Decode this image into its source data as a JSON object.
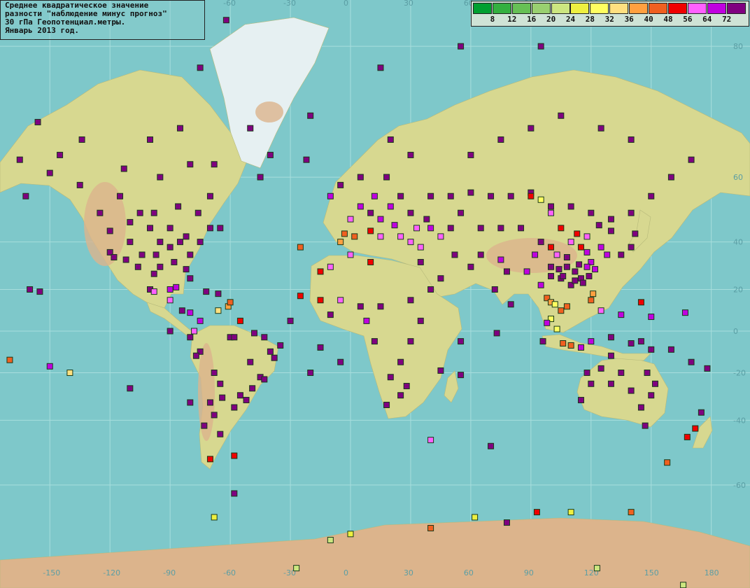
{
  "info": {
    "line1": "Среднее квадратическое значение",
    "line2": "разности \"наблюдение минус прогноз\"",
    "line3": "30 гПа Геопотенциал.метры.",
    "line4": "Январь 2013 год."
  },
  "legend": {
    "labels": [
      "8",
      "12",
      "16",
      "20",
      "24",
      "28",
      "32",
      "36",
      "40",
      "48",
      "56",
      "64",
      "72"
    ],
    "colors": [
      "#00a030",
      "#33b040",
      "#66c055",
      "#99d070",
      "#cce680",
      "#eef040",
      "#ffff60",
      "#ffe080",
      "#ffa040",
      "#f06020",
      "#f00000",
      "#ff60ff",
      "#c000e0",
      "#800080"
    ]
  },
  "axes": {
    "lon_labels": [
      "-150",
      "-120",
      "-90",
      "-60",
      "-30",
      "0",
      "30",
      "60",
      "90",
      "120",
      "150",
      "180"
    ],
    "lat_labels": [
      "80",
      "60",
      "40",
      "20",
      "0",
      "-20",
      "-40",
      "-60"
    ],
    "top_lon_labels": [
      "-60",
      "-30",
      "0",
      "30",
      "60",
      "90",
      "120",
      "150",
      "180"
    ]
  },
  "map_colors": {
    "ocean": "#7ec8ca",
    "land": "#d7d890",
    "highland": "#dcb48c",
    "ice": "#e6f0f2",
    "grid": "#a8dedd"
  },
  "stations": [
    {
      "lon": -97,
      "lat": 35,
      "c": 13
    },
    {
      "lon": -90,
      "lat": 38,
      "c": 13
    },
    {
      "lon": -85,
      "lat": 40,
      "c": 13
    },
    {
      "lon": -100,
      "lat": 45,
      "c": 13
    },
    {
      "lon": -110,
      "lat": 40,
      "c": 13
    },
    {
      "lon": -120,
      "lat": 44,
      "c": 13
    },
    {
      "lon": -80,
      "lat": 35,
      "c": 13
    },
    {
      "lon": -75,
      "lat": 40,
      "c": 13
    },
    {
      "lon": -95,
      "lat": 30,
      "c": 13
    },
    {
      "lon": -105,
      "lat": 50,
      "c": 13
    },
    {
      "lon": -115,
      "lat": 55,
      "c": 13
    },
    {
      "lon": -125,
      "lat": 50,
      "c": 13
    },
    {
      "lon": -135,
      "lat": 58,
      "c": 13
    },
    {
      "lon": -150,
      "lat": 61,
      "c": 13
    },
    {
      "lon": -165,
      "lat": 64,
      "c": 13
    },
    {
      "lon": -95,
      "lat": 60,
      "c": 13
    },
    {
      "lon": -70,
      "lat": 55,
      "c": 13
    },
    {
      "lon": -65,
      "lat": 45,
      "c": 13
    },
    {
      "lon": -100,
      "lat": 20,
      "c": 13
    },
    {
      "lon": -90,
      "lat": 15,
      "c": 11
    },
    {
      "lon": -80,
      "lat": 25,
      "c": 13
    },
    {
      "lon": -106,
      "lat": 30,
      "c": 13
    },
    {
      "lon": -85,
      "lat": 70,
      "c": 13
    },
    {
      "lon": -62,
      "lat": 82,
      "c": 13
    },
    {
      "lon": -75,
      "lat": 78,
      "c": 13
    },
    {
      "lon": -40,
      "lat": 65,
      "c": 13
    },
    {
      "lon": -22,
      "lat": 64,
      "c": 13
    },
    {
      "lon": -20,
      "lat": 72,
      "c": 13
    },
    {
      "lon": -50,
      "lat": 70,
      "c": 13
    },
    {
      "lon": -60,
      "lat": -3,
      "c": 13
    },
    {
      "lon": -50,
      "lat": -15,
      "c": 13
    },
    {
      "lon": -45,
      "lat": -22,
      "c": 13
    },
    {
      "lon": -55,
      "lat": -30,
      "c": 13
    },
    {
      "lon": -65,
      "lat": -25,
      "c": 13
    },
    {
      "lon": -70,
      "lat": -33,
      "c": 13
    },
    {
      "lon": -75,
      "lat": -10,
      "c": 13
    },
    {
      "lon": -40,
      "lat": -10,
      "c": 13
    },
    {
      "lon": -35,
      "lat": -7,
      "c": 13
    },
    {
      "lon": -65,
      "lat": -45,
      "c": 13
    },
    {
      "lon": -70,
      "lat": -53,
      "c": 10
    },
    {
      "lon": -58,
      "lat": -52,
      "c": 10
    },
    {
      "lon": -78,
      "lat": 0,
      "c": 11
    },
    {
      "lon": -75,
      "lat": 5,
      "c": 12
    },
    {
      "lon": -66,
      "lat": 10,
      "c": 7
    },
    {
      "lon": -61,
      "lat": 12,
      "c": 8
    },
    {
      "lon": -55,
      "lat": 5,
      "c": 10
    },
    {
      "lon": -175,
      "lat": -20,
      "c": 4
    },
    {
      "lon": -150,
      "lat": -17,
      "c": 12
    },
    {
      "lon": -160,
      "lat": 20,
      "c": 13
    },
    {
      "lon": -155,
      "lat": 19,
      "c": 13
    },
    {
      "lon": -170,
      "lat": -14,
      "c": 9
    },
    {
      "lon": 10,
      "lat": 50,
      "c": 13
    },
    {
      "lon": 20,
      "lat": 52,
      "c": 12
    },
    {
      "lon": 15,
      "lat": 48,
      "c": 12
    },
    {
      "lon": 25,
      "lat": 55,
      "c": 13
    },
    {
      "lon": 30,
      "lat": 50,
      "c": 13
    },
    {
      "lon": 5,
      "lat": 52,
      "c": 12
    },
    {
      "lon": 0,
      "lat": 48,
      "c": 11
    },
    {
      "lon": -5,
      "lat": 40,
      "c": 8
    },
    {
      "lon": -3,
      "lat": 43,
      "c": 9
    },
    {
      "lon": 2,
      "lat": 42,
      "c": 9
    },
    {
      "lon": 10,
      "lat": 44,
      "c": 10
    },
    {
      "lon": 15,
      "lat": 42,
      "c": 11
    },
    {
      "lon": 25,
      "lat": 42,
      "c": 11
    },
    {
      "lon": 30,
      "lat": 40,
      "c": 11
    },
    {
      "lon": 35,
      "lat": 38,
      "c": 11
    },
    {
      "lon": 40,
      "lat": 45,
      "c": 12
    },
    {
      "lon": 45,
      "lat": 42,
      "c": 11
    },
    {
      "lon": 38,
      "lat": 48,
      "c": 13
    },
    {
      "lon": 40,
      "lat": 55,
      "c": 13
    },
    {
      "lon": 50,
      "lat": 55,
      "c": 13
    },
    {
      "lon": 60,
      "lat": 56,
      "c": 13
    },
    {
      "lon": 70,
      "lat": 55,
      "c": 13
    },
    {
      "lon": 80,
      "lat": 55,
      "c": 13
    },
    {
      "lon": 90,
      "lat": 56,
      "c": 13
    },
    {
      "lon": 100,
      "lat": 52,
      "c": 13
    },
    {
      "lon": 110,
      "lat": 52,
      "c": 13
    },
    {
      "lon": 120,
      "lat": 50,
      "c": 13
    },
    {
      "lon": 130,
      "lat": 48,
      "c": 13
    },
    {
      "lon": 140,
      "lat": 50,
      "c": 13
    },
    {
      "lon": 150,
      "lat": 55,
      "c": 13
    },
    {
      "lon": 160,
      "lat": 60,
      "c": 13
    },
    {
      "lon": 170,
      "lat": 64,
      "c": 13
    },
    {
      "lon": 60,
      "lat": 65,
      "c": 13
    },
    {
      "lon": 75,
      "lat": 68,
      "c": 13
    },
    {
      "lon": 90,
      "lat": 70,
      "c": 13
    },
    {
      "lon": 105,
      "lat": 72,
      "c": 13
    },
    {
      "lon": 125,
      "lat": 70,
      "c": 13
    },
    {
      "lon": 140,
      "lat": 68,
      "c": 13
    },
    {
      "lon": 30,
      "lat": 65,
      "c": 13
    },
    {
      "lon": 20,
      "lat": 68,
      "c": 13
    },
    {
      "lon": 15,
      "lat": 78,
      "c": 13
    },
    {
      "lon": 55,
      "lat": 80,
      "c": 13
    },
    {
      "lon": 95,
      "lat": 80,
      "c": 13
    },
    {
      "lon": 90,
      "lat": 55,
      "c": 10
    },
    {
      "lon": 95,
      "lat": 54,
      "c": 6
    },
    {
      "lon": 100,
      "lat": 50,
      "c": 11
    },
    {
      "lon": 105,
      "lat": 45,
      "c": 10
    },
    {
      "lon": 110,
      "lat": 40,
      "c": 11
    },
    {
      "lon": 115,
      "lat": 38,
      "c": 10
    },
    {
      "lon": 118,
      "lat": 36,
      "c": 12
    },
    {
      "lon": 120,
      "lat": 32,
      "c": 12
    },
    {
      "lon": 108,
      "lat": 34,
      "c": 13
    },
    {
      "lon": 112,
      "lat": 28,
      "c": 13
    },
    {
      "lon": 115,
      "lat": 25,
      "c": 13
    },
    {
      "lon": 105,
      "lat": 25,
      "c": 13
    },
    {
      "lon": 100,
      "lat": 30,
      "c": 13
    },
    {
      "lon": 110,
      "lat": 22,
      "c": 13
    },
    {
      "lon": 95,
      "lat": 22,
      "c": 12
    },
    {
      "lon": 88,
      "lat": 28,
      "c": 12
    },
    {
      "lon": 78,
      "lat": 28,
      "c": 13
    },
    {
      "lon": 72,
      "lat": 20,
      "c": 13
    },
    {
      "lon": 80,
      "lat": 13,
      "c": 13
    },
    {
      "lon": 75,
      "lat": 33,
      "c": 12
    },
    {
      "lon": 65,
      "lat": 35,
      "c": 13
    },
    {
      "lon": 60,
      "lat": 30,
      "c": 13
    },
    {
      "lon": 52,
      "lat": 35,
      "c": 13
    },
    {
      "lon": 45,
      "lat": 25,
      "c": 13
    },
    {
      "lon": 40,
      "lat": 20,
      "c": 13
    },
    {
      "lon": 125,
      "lat": 38,
      "c": 12
    },
    {
      "lon": 128,
      "lat": 35,
      "c": 12
    },
    {
      "lon": 135,
      "lat": 35,
      "c": 13
    },
    {
      "lon": 140,
      "lat": 38,
      "c": 13
    },
    {
      "lon": 142,
      "lat": 43,
      "c": 13
    },
    {
      "lon": 120,
      "lat": 15,
      "c": 9
    },
    {
      "lon": 121,
      "lat": 18,
      "c": 8
    },
    {
      "lon": 125,
      "lat": 10,
      "c": 11
    },
    {
      "lon": 103,
      "lat": 1,
      "c": 6
    },
    {
      "lon": 106,
      "lat": -6,
      "c": 9
    },
    {
      "lon": 110,
      "lat": -7,
      "c": 9
    },
    {
      "lon": 115,
      "lat": -8,
      "c": 12
    },
    {
      "lon": 120,
      "lat": -5,
      "c": 12
    },
    {
      "lon": 130,
      "lat": -3,
      "c": 13
    },
    {
      "lon": 140,
      "lat": -6,
      "c": 13
    },
    {
      "lon": 145,
      "lat": -5,
      "c": 13
    },
    {
      "lon": 150,
      "lat": -9,
      "c": 13
    },
    {
      "lon": 160,
      "lat": -9,
      "c": 13
    },
    {
      "lon": 170,
      "lat": -15,
      "c": 13
    },
    {
      "lon": 150,
      "lat": 7,
      "c": 12
    },
    {
      "lon": 145,
      "lat": 14,
      "c": 10
    },
    {
      "lon": 135,
      "lat": 8,
      "c": 12
    },
    {
      "lon": 167,
      "lat": 9,
      "c": 12
    },
    {
      "lon": -10,
      "lat": 30,
      "c": 11
    },
    {
      "lon": 0,
      "lat": 35,
      "c": 11
    },
    {
      "lon": 10,
      "lat": 32,
      "c": 10
    },
    {
      "lon": -15,
      "lat": 15,
      "c": 10
    },
    {
      "lon": -5,
      "lat": 15,
      "c": 11
    },
    {
      "lon": 5,
      "lat": 12,
      "c": 13
    },
    {
      "lon": 15,
      "lat": 12,
      "c": 13
    },
    {
      "lon": 30,
      "lat": 15,
      "c": 13
    },
    {
      "lon": 35,
      "lat": 5,
      "c": 13
    },
    {
      "lon": 30,
      "lat": -5,
      "c": 13
    },
    {
      "lon": 25,
      "lat": -15,
      "c": 13
    },
    {
      "lon": 28,
      "lat": -26,
      "c": 13
    },
    {
      "lon": 18,
      "lat": -34,
      "c": 13
    },
    {
      "lon": 25,
      "lat": -30,
      "c": 13
    },
    {
      "lon": 20,
      "lat": -22,
      "c": 13
    },
    {
      "lon": 12,
      "lat": -5,
      "c": 13
    },
    {
      "lon": 45,
      "lat": -19,
      "c": 13
    },
    {
      "lon": 55,
      "lat": -21,
      "c": 13
    },
    {
      "lon": 8,
      "lat": 5,
      "c": 12
    },
    {
      "lon": -10,
      "lat": 8,
      "c": 13
    },
    {
      "lon": -25,
      "lat": 38,
      "c": 9
    },
    {
      "lon": -15,
      "lat": 28,
      "c": 10
    },
    {
      "lon": -25,
      "lat": 17,
      "c": 10
    },
    {
      "lon": -5,
      "lat": -15,
      "c": 13
    },
    {
      "lon": -15,
      "lat": -8,
      "c": 13
    },
    {
      "lon": 40,
      "lat": -47,
      "c": 11
    },
    {
      "lon": 70,
      "lat": -49,
      "c": 13
    },
    {
      "lon": 55,
      "lat": -5,
      "c": 13
    },
    {
      "lon": 73,
      "lat": -1,
      "c": 13
    },
    {
      "lon": 115,
      "lat": -32,
      "c": 13
    },
    {
      "lon": 120,
      "lat": -25,
      "c": 13
    },
    {
      "lon": 130,
      "lat": -25,
      "c": 13
    },
    {
      "lon": 135,
      "lat": -20,
      "c": 13
    },
    {
      "lon": 140,
      "lat": -28,
      "c": 13
    },
    {
      "lon": 145,
      "lat": -35,
      "c": 13
    },
    {
      "lon": 150,
      "lat": -30,
      "c": 13
    },
    {
      "lon": 152,
      "lat": -25,
      "c": 13
    },
    {
      "lon": 148,
      "lat": -20,
      "c": 13
    },
    {
      "lon": 130,
      "lat": -12,
      "c": 13
    },
    {
      "lon": 125,
      "lat": -18,
      "c": 13
    },
    {
      "lon": 118,
      "lat": -20,
      "c": 13
    },
    {
      "lon": 147,
      "lat": -42,
      "c": 13
    },
    {
      "lon": 175,
      "lat": -37,
      "c": 13
    },
    {
      "lon": 172,
      "lat": -43,
      "c": 10
    },
    {
      "lon": 168,
      "lat": -46,
      "c": 10
    },
    {
      "lon": 158,
      "lat": -54,
      "c": 9
    },
    {
      "lon": 178,
      "lat": -18,
      "c": 13
    },
    {
      "lon": -178,
      "lat": -14,
      "c": 13
    },
    {
      "lon": -68,
      "lat": -67,
      "c": 5
    },
    {
      "lon": -58,
      "lat": -62,
      "c": 13
    },
    {
      "lon": -27,
      "lat": -75,
      "c": 4
    },
    {
      "lon": -10,
      "lat": -71,
      "c": 4
    },
    {
      "lon": 0,
      "lat": -70,
      "c": 5
    },
    {
      "lon": 40,
      "lat": -69,
      "c": 9
    },
    {
      "lon": 62,
      "lat": -67,
      "c": 5
    },
    {
      "lon": 78,
      "lat": -68,
      "c": 13
    },
    {
      "lon": 93,
      "lat": -66,
      "c": 10
    },
    {
      "lon": 110,
      "lat": -66,
      "c": 5
    },
    {
      "lon": 140,
      "lat": -66,
      "c": 9
    },
    {
      "lon": 166,
      "lat": -77,
      "c": 4
    },
    {
      "lon": 123,
      "lat": -75,
      "c": 4
    },
    {
      "lon": -140,
      "lat": -20,
      "c": 7
    },
    {
      "lon": -30,
      "lat": 5,
      "c": 13
    },
    {
      "lon": -20,
      "lat": -20,
      "c": 13
    },
    {
      "lon": -110,
      "lat": -27,
      "c": 13
    },
    {
      "lon": -80,
      "lat": -33,
      "c": 13
    },
    {
      "lon": -90,
      "lat": 0,
      "c": 13
    },
    {
      "lon": -45,
      "lat": 60,
      "c": 13
    },
    {
      "lon": -10,
      "lat": 55,
      "c": 12
    },
    {
      "lon": -5,
      "lat": 58,
      "c": 13
    },
    {
      "lon": 5,
      "lat": 60,
      "c": 13
    },
    {
      "lon": 18,
      "lat": 60,
      "c": 13
    },
    {
      "lon": 12,
      "lat": 55,
      "c": 12
    },
    {
      "lon": 22,
      "lat": 46,
      "c": 12
    },
    {
      "lon": 35,
      "lat": 32,
      "c": 13
    },
    {
      "lon": 33,
      "lat": 45,
      "c": 11
    },
    {
      "lon": 50,
      "lat": 45,
      "c": 13
    },
    {
      "lon": 55,
      "lat": 50,
      "c": 13
    },
    {
      "lon": 65,
      "lat": 45,
      "c": 13
    },
    {
      "lon": 75,
      "lat": 45,
      "c": 13
    },
    {
      "lon": 85,
      "lat": 45,
      "c": 13
    },
    {
      "lon": 95,
      "lat": 40,
      "c": 13
    },
    {
      "lon": 100,
      "lat": 38,
      "c": 10
    },
    {
      "lon": 92,
      "lat": 35,
      "c": 12
    },
    {
      "lon": 103,
      "lat": 35,
      "c": 11
    },
    {
      "lon": 113,
      "lat": 43,
      "c": 10
    },
    {
      "lon": 118,
      "lat": 42,
      "c": 11
    },
    {
      "lon": 124,
      "lat": 46,
      "c": 13
    },
    {
      "lon": 130,
      "lat": 44,
      "c": 13
    },
    {
      "lon": 122,
      "lat": 29,
      "c": 12
    },
    {
      "lon": 118,
      "lat": 30,
      "c": 12
    },
    {
      "lon": 114,
      "lat": 31,
      "c": 13
    },
    {
      "lon": 108,
      "lat": 30,
      "c": 13
    },
    {
      "lon": 104,
      "lat": 29,
      "c": 13
    },
    {
      "lon": 100,
      "lat": 26,
      "c": 13
    },
    {
      "lon": 106,
      "lat": 26,
      "c": 13
    },
    {
      "lon": 112,
      "lat": 24,
      "c": 13
    },
    {
      "lon": 116,
      "lat": 23,
      "c": 13
    },
    {
      "lon": 119,
      "lat": 26,
      "c": 13
    },
    {
      "lon": 98,
      "lat": 16,
      "c": 9
    },
    {
      "lon": 100,
      "lat": 14,
      "c": 8
    },
    {
      "lon": 102,
      "lat": 13,
      "c": 6
    },
    {
      "lon": 105,
      "lat": 10,
      "c": 9
    },
    {
      "lon": 100,
      "lat": 6,
      "c": 6
    },
    {
      "lon": 98,
      "lat": 4,
      "c": 12
    },
    {
      "lon": 108,
      "lat": 12,
      "c": 9
    },
    {
      "lon": 96,
      "lat": -5,
      "c": 13
    },
    {
      "lon": -120,
      "lat": 36,
      "c": 13
    },
    {
      "lon": -118,
      "lat": 34,
      "c": 13
    },
    {
      "lon": -112,
      "lat": 33,
      "c": 13
    },
    {
      "lon": -104,
      "lat": 35,
      "c": 13
    },
    {
      "lon": -95,
      "lat": 40,
      "c": 13
    },
    {
      "lon": -90,
      "lat": 45,
      "c": 13
    },
    {
      "lon": -82,
      "lat": 42,
      "c": 13
    },
    {
      "lon": -70,
      "lat": 45,
      "c": 13
    },
    {
      "lon": -88,
      "lat": 32,
      "c": 13
    },
    {
      "lon": -82,
      "lat": 29,
      "c": 13
    },
    {
      "lon": -98,
      "lat": 27,
      "c": 13
    },
    {
      "lon": -110,
      "lat": 47,
      "c": 13
    },
    {
      "lon": -98,
      "lat": 50,
      "c": 13
    },
    {
      "lon": -86,
      "lat": 52,
      "c": 13
    },
    {
      "lon": -76,
      "lat": 50,
      "c": 13
    },
    {
      "lon": -113,
      "lat": 62,
      "c": 13
    },
    {
      "lon": -134,
      "lat": 68,
      "c": 13
    },
    {
      "lon": -156,
      "lat": 71,
      "c": 13
    },
    {
      "lon": -145,
      "lat": 65,
      "c": 13
    },
    {
      "lon": -162,
      "lat": 55,
      "c": 13
    },
    {
      "lon": -176,
      "lat": 52,
      "c": 13
    },
    {
      "lon": -100,
      "lat": 68,
      "c": 13
    },
    {
      "lon": -80,
      "lat": 63,
      "c": 13
    },
    {
      "lon": -68,
      "lat": 63,
      "c": 13
    },
    {
      "lon": -87,
      "lat": 21,
      "c": 12
    },
    {
      "lon": -98,
      "lat": 19,
      "c": 11
    },
    {
      "lon": -90,
      "lat": 20,
      "c": 12
    },
    {
      "lon": -80,
      "lat": 9,
      "c": 12
    },
    {
      "lon": -84,
      "lat": 10,
      "c": 13
    },
    {
      "lon": -72,
      "lat": 19,
      "c": 13
    },
    {
      "lon": -66,
      "lat": 18,
      "c": 13
    },
    {
      "lon": -60,
      "lat": 14,
      "c": 9
    },
    {
      "lon": -58,
      "lat": -3,
      "c": 13
    },
    {
      "lon": -48,
      "lat": -1,
      "c": 13
    },
    {
      "lon": -43,
      "lat": -3,
      "c": 13
    },
    {
      "lon": -38,
      "lat": -13,
      "c": 13
    },
    {
      "lon": -43,
      "lat": -23,
      "c": 13
    },
    {
      "lon": -49,
      "lat": -27,
      "c": 13
    },
    {
      "lon": -52,
      "lat": -32,
      "c": 13
    },
    {
      "lon": -58,
      "lat": -35,
      "c": 13
    },
    {
      "lon": -64,
      "lat": -31,
      "c": 13
    },
    {
      "lon": -68,
      "lat": -20,
      "c": 13
    },
    {
      "lon": -77,
      "lat": -12,
      "c": 13
    },
    {
      "lon": -80,
      "lat": -3,
      "c": 13
    },
    {
      "lon": -73,
      "lat": -42,
      "c": 13
    },
    {
      "lon": -68,
      "lat": -38,
      "c": 13
    }
  ]
}
